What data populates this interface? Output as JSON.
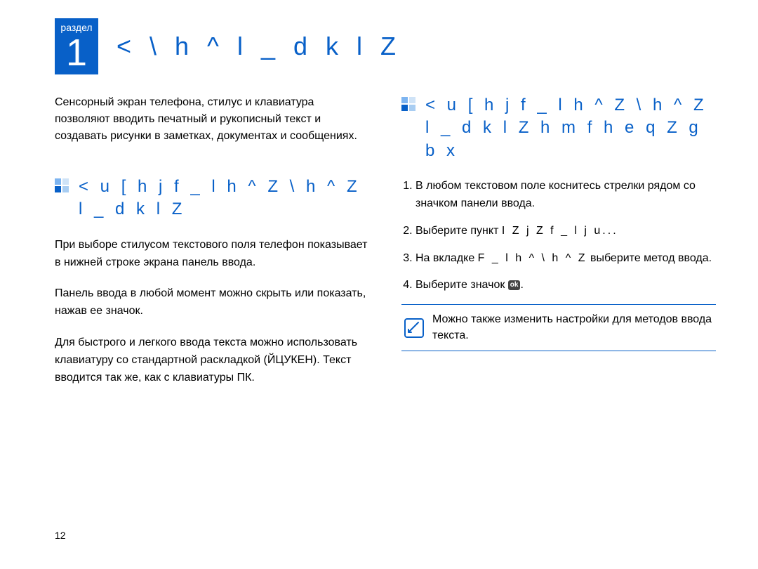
{
  "chapter": {
    "label": "раздел",
    "number": "1",
    "title": "< \\ h ^ l _ d k l Z"
  },
  "left": {
    "intro": "Сенсорный экран телефона, стилус и клавиатура позволяют вводить печатный и рукописный текст и создавать рисунки в заметках, документах и сообщениях.",
    "heading": "< u [ h j f _ l h ^ Z \\ h ^ Z l _ d k l Z",
    "p1": "При выборе стилусом текстового поля телефон показывает в нижней строке экрана панель ввода.",
    "p2": "Панель ввода в любой момент можно скрыть или показать, нажав ее значок.",
    "p3": "Для быстрого и легкого ввода текста можно использовать клавиатуру со стандартной раскладкой (ЙЦУКЕН). Текст вводится так же, как с клавиатуры ПК."
  },
  "right": {
    "heading": "< u [ h j f _ l h ^ Z \\ h ^ Z l _ d k l Z h m f h e q Z g b x",
    "steps": {
      "s1": "В любом текстовом поле коснитесь стрелки рядом со значком панели ввода.",
      "s2a": "Выберите пункт ",
      "s2b": "I Z j Z f _ l j u...",
      "s3a": "На вкладке ",
      "s3b": "F _ l h ^ \\ h ^ Z",
      "s3c": " выберите метод ввода.",
      "s4a": "Выберите значок ",
      "s4ok": "ok",
      "s4b": "."
    },
    "note": "Можно также изменить настройки для методов ввода текста."
  },
  "pageNumber": "12"
}
